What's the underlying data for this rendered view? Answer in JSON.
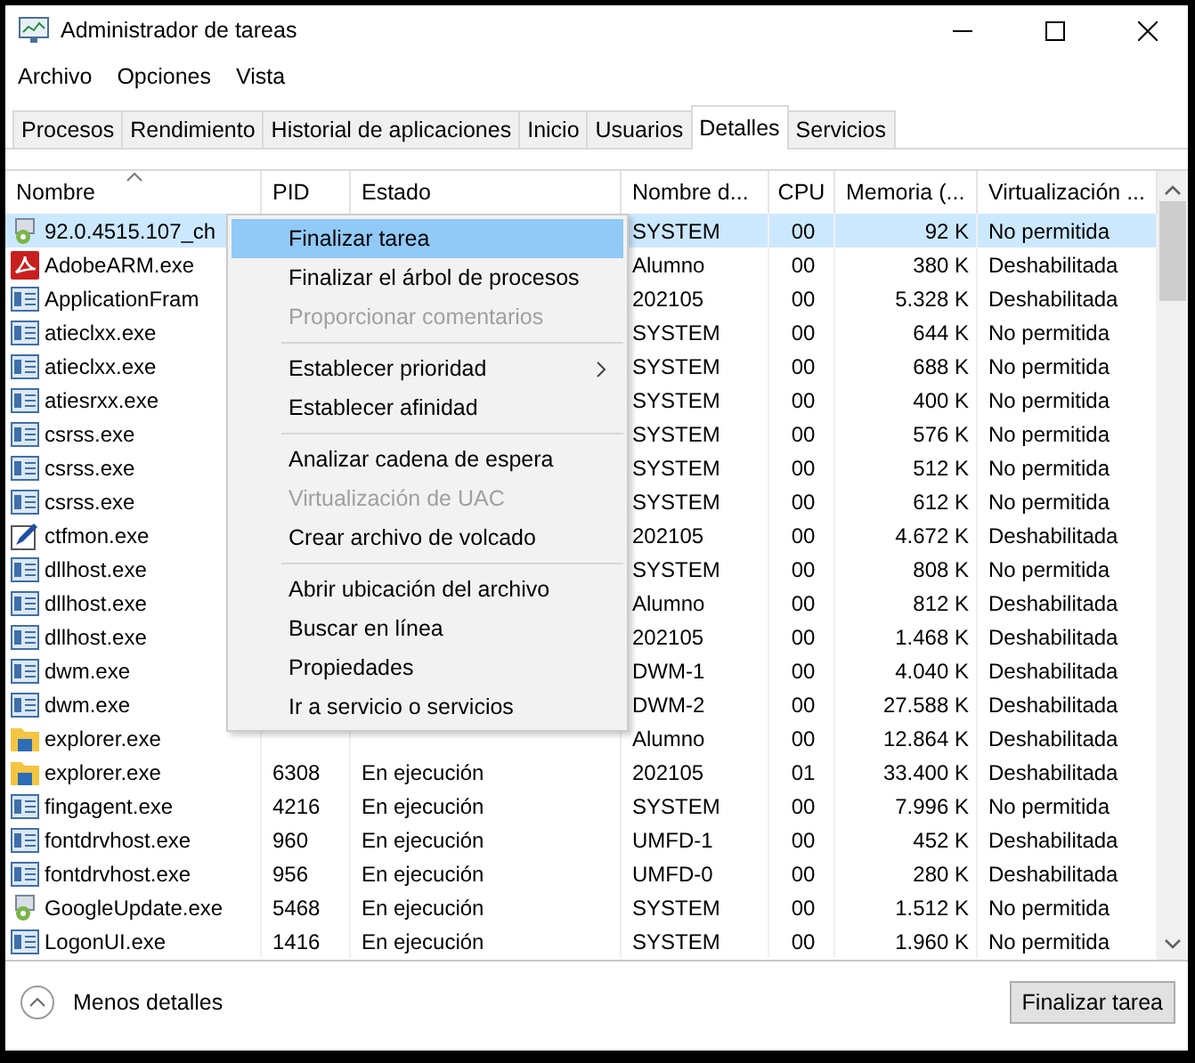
{
  "window": {
    "title": "Administrador de tareas"
  },
  "menu_bar": [
    "Archivo",
    "Opciones",
    "Vista"
  ],
  "tabs": [
    {
      "label": "Procesos",
      "selected": false
    },
    {
      "label": "Rendimiento",
      "selected": false
    },
    {
      "label": "Historial de aplicaciones",
      "selected": false
    },
    {
      "label": "Inicio",
      "selected": false
    },
    {
      "label": "Usuarios",
      "selected": false
    },
    {
      "label": "Detalles",
      "selected": true
    },
    {
      "label": "Servicios",
      "selected": false
    }
  ],
  "table": {
    "columns": [
      {
        "label": "Nombre",
        "sorted": true
      },
      {
        "label": "PID",
        "sorted": false
      },
      {
        "label": "Estado",
        "sorted": false
      },
      {
        "label": "Nombre d...",
        "sorted": false
      },
      {
        "label": "CPU",
        "sorted": false
      },
      {
        "label": "Memoria (...",
        "sorted": false
      },
      {
        "label": "Virtualización ...",
        "sorted": false
      }
    ],
    "rows": [
      {
        "kind": "setup",
        "name": "92.0.4515.107_ch",
        "user": "SYSTEM",
        "cpu": "00",
        "memory": "92 K",
        "virtualization": "No permitida",
        "selected": true
      },
      {
        "kind": "adobe",
        "name": "AdobeARM.exe",
        "user": "Alumno",
        "cpu": "00",
        "memory": "380 K",
        "virtualization": "Deshabilitada",
        "selected": false
      },
      {
        "kind": "window",
        "name": "ApplicationFram",
        "user": "202105",
        "cpu": "00",
        "memory": "5.328 K",
        "virtualization": "Deshabilitada",
        "selected": false
      },
      {
        "kind": "window",
        "name": "atieclxx.exe",
        "user": "SYSTEM",
        "cpu": "00",
        "memory": "644 K",
        "virtualization": "No permitida",
        "selected": false
      },
      {
        "kind": "window",
        "name": "atieclxx.exe",
        "user": "SYSTEM",
        "cpu": "00",
        "memory": "688 K",
        "virtualization": "No permitida",
        "selected": false
      },
      {
        "kind": "window",
        "name": "atiesrxx.exe",
        "user": "SYSTEM",
        "cpu": "00",
        "memory": "400 K",
        "virtualization": "No permitida",
        "selected": false
      },
      {
        "kind": "window",
        "name": "csrss.exe",
        "user": "SYSTEM",
        "cpu": "00",
        "memory": "576 K",
        "virtualization": "No permitida",
        "selected": false
      },
      {
        "kind": "window",
        "name": "csrss.exe",
        "user": "SYSTEM",
        "cpu": "00",
        "memory": "512 K",
        "virtualization": "No permitida",
        "selected": false
      },
      {
        "kind": "window",
        "name": "csrss.exe",
        "user": "SYSTEM",
        "cpu": "00",
        "memory": "612 K",
        "virtualization": "No permitida",
        "selected": false
      },
      {
        "kind": "pen",
        "name": "ctfmon.exe",
        "user": "202105",
        "cpu": "00",
        "memory": "4.672 K",
        "virtualization": "Deshabilitada",
        "selected": false
      },
      {
        "kind": "window",
        "name": "dllhost.exe",
        "user": "SYSTEM",
        "cpu": "00",
        "memory": "808 K",
        "virtualization": "No permitida",
        "selected": false
      },
      {
        "kind": "window",
        "name": "dllhost.exe",
        "user": "Alumno",
        "cpu": "00",
        "memory": "812 K",
        "virtualization": "Deshabilitada",
        "selected": false
      },
      {
        "kind": "window",
        "name": "dllhost.exe",
        "user": "202105",
        "cpu": "00",
        "memory": "1.468 K",
        "virtualization": "Deshabilitada",
        "selected": false
      },
      {
        "kind": "window",
        "name": "dwm.exe",
        "user": "DWM-1",
        "cpu": "00",
        "memory": "4.040 K",
        "virtualization": "Deshabilitada",
        "selected": false
      },
      {
        "kind": "window",
        "name": "dwm.exe",
        "user": "DWM-2",
        "cpu": "00",
        "memory": "27.588 K",
        "virtualization": "Deshabilitada",
        "selected": false
      },
      {
        "kind": "folder",
        "name": "explorer.exe",
        "user": "Alumno",
        "cpu": "00",
        "memory": "12.864 K",
        "virtualization": "Deshabilitada",
        "selected": false
      },
      {
        "kind": "folder",
        "name": "explorer.exe",
        "pid": "6308",
        "status": "En ejecución",
        "user": "202105",
        "cpu": "01",
        "memory": "33.400 K",
        "virtualization": "Deshabilitada",
        "selected": false
      },
      {
        "kind": "window",
        "name": "fingagent.exe",
        "pid": "4216",
        "status": "En ejecución",
        "user": "SYSTEM",
        "cpu": "00",
        "memory": "7.996 K",
        "virtualization": "No permitida",
        "selected": false
      },
      {
        "kind": "window",
        "name": "fontdrvhost.exe",
        "pid": "960",
        "status": "En ejecución",
        "user": "UMFD-1",
        "cpu": "00",
        "memory": "452 K",
        "virtualization": "Deshabilitada",
        "selected": false
      },
      {
        "kind": "window",
        "name": "fontdrvhost.exe",
        "pid": "956",
        "status": "En ejecución",
        "user": "UMFD-0",
        "cpu": "00",
        "memory": "280 K",
        "virtualization": "Deshabilitada",
        "selected": false
      },
      {
        "kind": "setup",
        "name": "GoogleUpdate.exe",
        "pid": "5468",
        "status": "En ejecución",
        "user": "SYSTEM",
        "cpu": "00",
        "memory": "1.512 K",
        "virtualization": "No permitida",
        "selected": false
      },
      {
        "kind": "window",
        "name": "LogonUI.exe",
        "pid": "1416",
        "status": "En ejecución",
        "user": "SYSTEM",
        "cpu": "00",
        "memory": "1.960 K",
        "virtualization": "No permitida",
        "selected": false
      }
    ]
  },
  "context_menu": {
    "items": [
      {
        "kind": "item",
        "label": "Finalizar tarea",
        "disabled": false,
        "selected": true,
        "submenu": false
      },
      {
        "kind": "item",
        "label": "Finalizar el árbol de procesos",
        "disabled": false,
        "selected": false,
        "submenu": false
      },
      {
        "kind": "item",
        "label": "Proporcionar comentarios",
        "disabled": true,
        "selected": false,
        "submenu": false
      },
      {
        "kind": "separator"
      },
      {
        "kind": "item",
        "label": "Establecer prioridad",
        "disabled": false,
        "selected": false,
        "submenu": true
      },
      {
        "kind": "item",
        "label": "Establecer afinidad",
        "disabled": false,
        "selected": false,
        "submenu": false
      },
      {
        "kind": "separator"
      },
      {
        "kind": "item",
        "label": "Analizar cadena de espera",
        "disabled": false,
        "selected": false,
        "submenu": false
      },
      {
        "kind": "item",
        "label": "Virtualización de UAC",
        "disabled": true,
        "selected": false,
        "submenu": false
      },
      {
        "kind": "item",
        "label": "Crear archivo de volcado",
        "disabled": false,
        "selected": false,
        "submenu": false
      },
      {
        "kind": "separator"
      },
      {
        "kind": "item",
        "label": "Abrir ubicación del archivo",
        "disabled": false,
        "selected": false,
        "submenu": false
      },
      {
        "kind": "item",
        "label": "Buscar en línea",
        "disabled": false,
        "selected": false,
        "submenu": false
      },
      {
        "kind": "item",
        "label": "Propiedades",
        "disabled": false,
        "selected": false,
        "submenu": false
      },
      {
        "kind": "item",
        "label": "Ir a servicio o servicios",
        "disabled": false,
        "selected": false,
        "submenu": false
      }
    ]
  },
  "footer": {
    "toggle": "Menos detalles",
    "button": "Finalizar tarea"
  }
}
